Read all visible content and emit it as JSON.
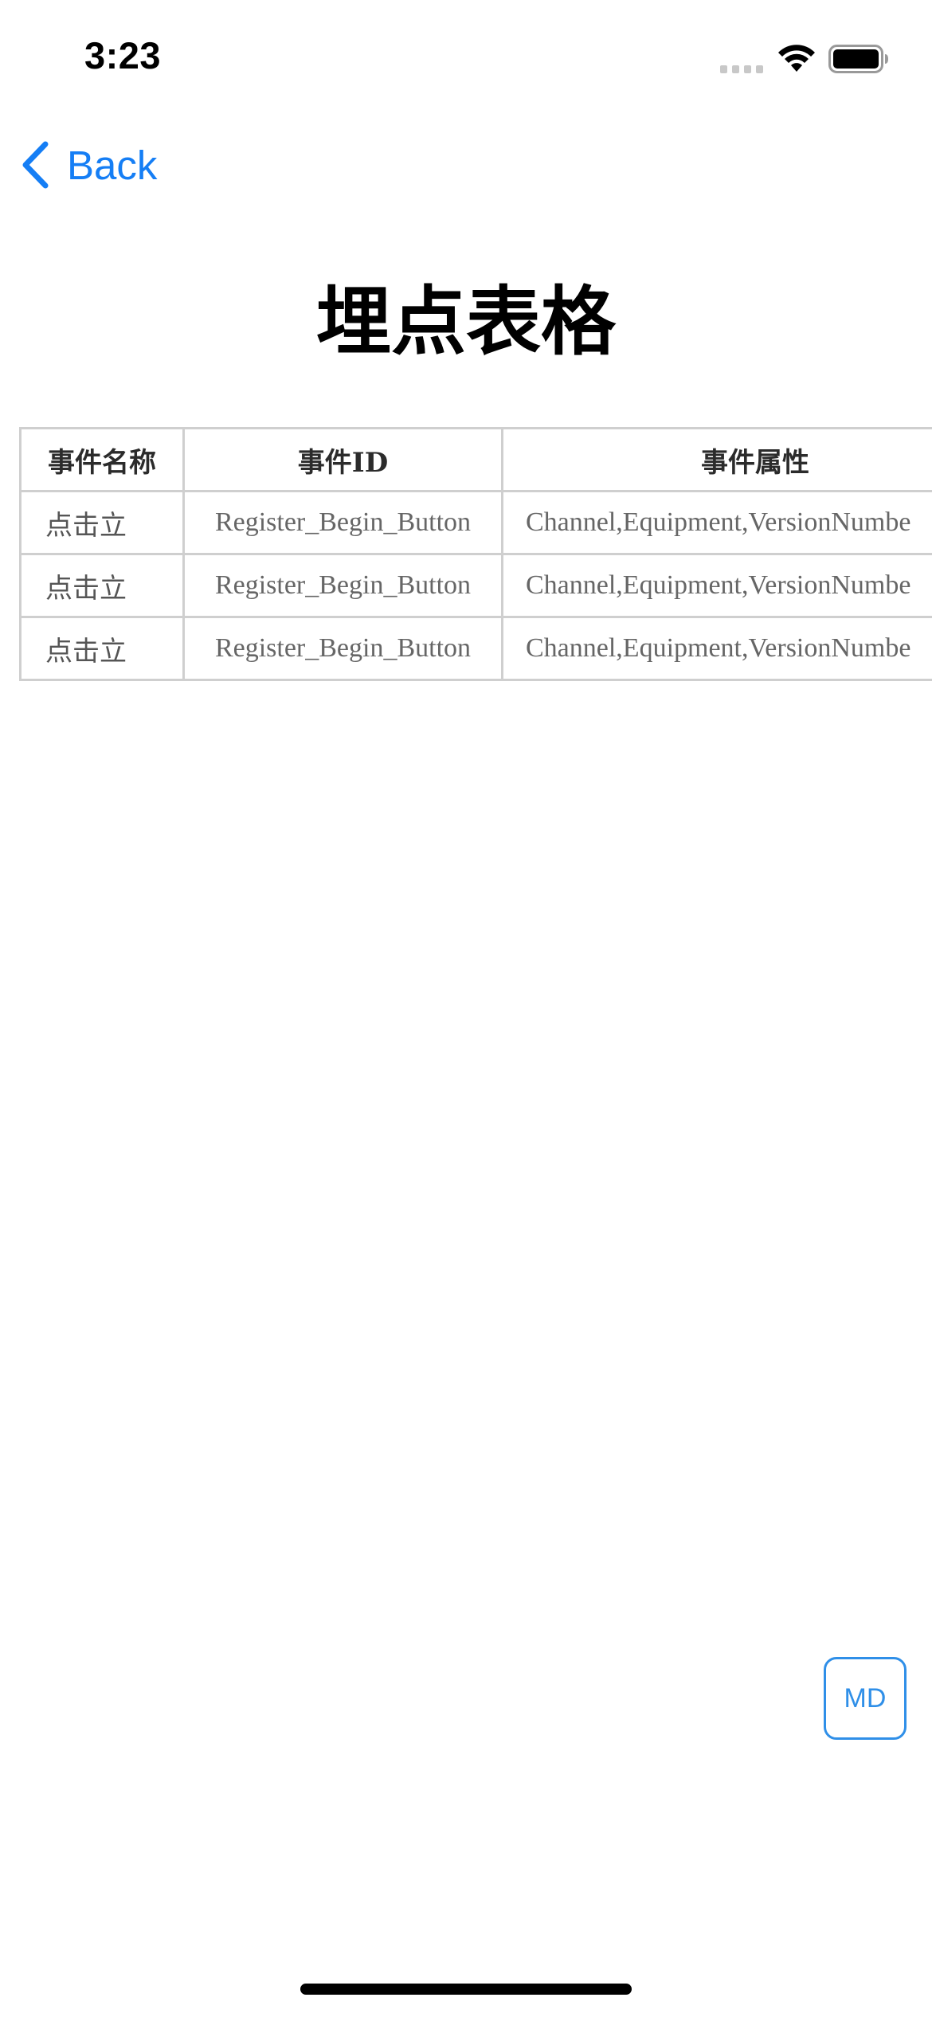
{
  "status_bar": {
    "time": "3:23",
    "icons": [
      "cellular-signal-icon",
      "wifi-icon",
      "battery-icon"
    ]
  },
  "nav": {
    "back_label": "Back",
    "back_icon": "chevron-left-icon",
    "accent_color": "#157ef5"
  },
  "page": {
    "title": "埋点表格"
  },
  "table": {
    "headers": [
      "事件名称",
      "事件ID",
      "事件属性"
    ],
    "rows": [
      [
        "点击立",
        "Register_Begin_Button",
        "Channel,Equipment,VersionNumbe"
      ],
      [
        "点击立",
        "Register_Begin_Button",
        "Channel,Equipment,VersionNumbe"
      ],
      [
        "点击立",
        "Register_Begin_Button",
        "Channel,Equipment,VersionNumbe"
      ]
    ],
    "border_color": "#cfcfcf"
  },
  "floating_button": {
    "label": "MD",
    "color": "#2f8fe8"
  }
}
